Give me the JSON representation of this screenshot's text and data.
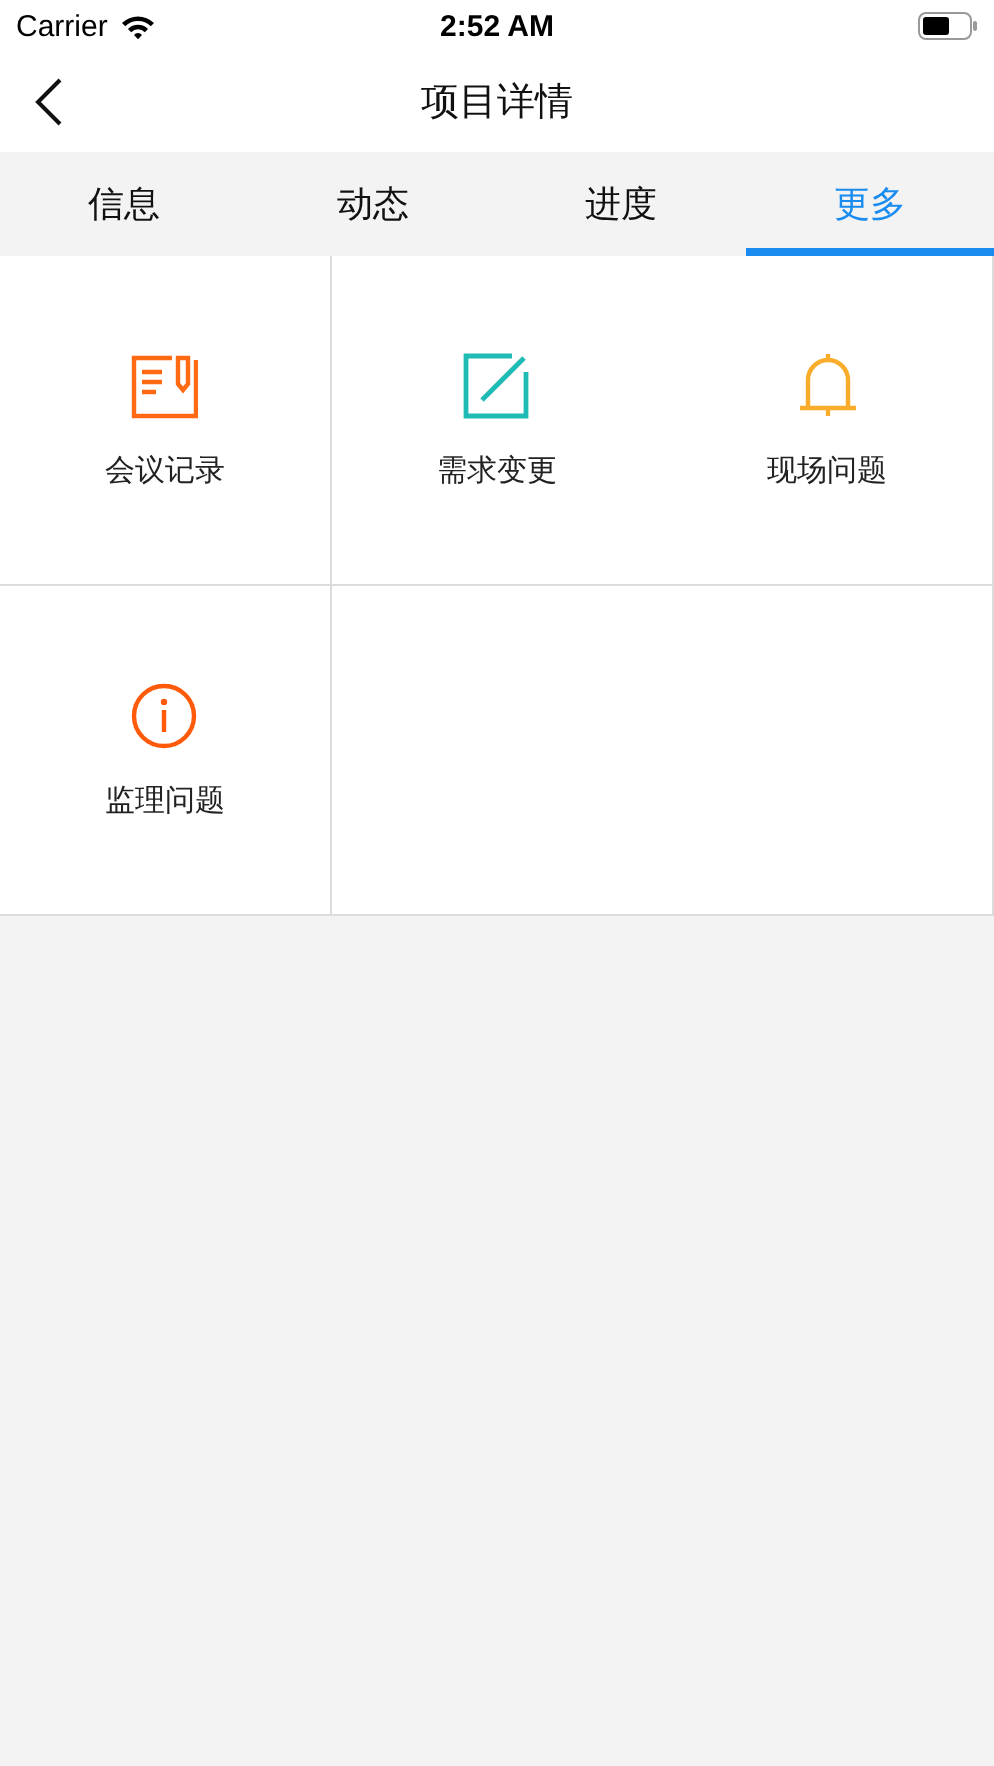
{
  "status_bar": {
    "carrier": "Carrier",
    "time": "2:52 AM"
  },
  "nav": {
    "title": "项目详情"
  },
  "tabs": [
    {
      "label": "信息",
      "selected": false
    },
    {
      "label": "动态",
      "selected": false
    },
    {
      "label": "进度",
      "selected": false
    },
    {
      "label": "更多",
      "selected": true
    }
  ],
  "grid": [
    {
      "label": "会议记录",
      "kind": "notebook",
      "color": "#ff6a13"
    },
    {
      "label": "需求变更",
      "kind": "edit",
      "color": "#1fbcb6"
    },
    {
      "label": "现场问题",
      "kind": "bell",
      "color": "#f9ad2a"
    },
    {
      "label": "监理问题",
      "kind": "info",
      "color": "#ff5a0a"
    }
  ]
}
